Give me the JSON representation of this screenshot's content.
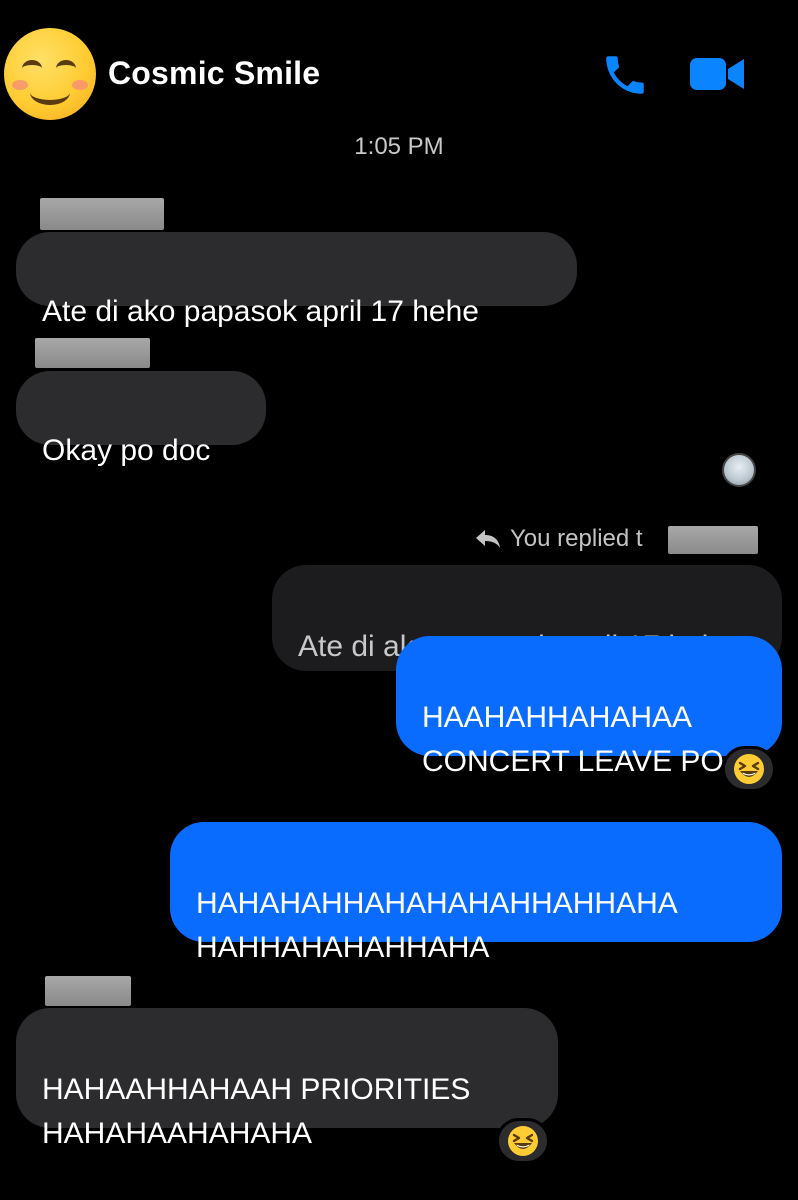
{
  "header": {
    "contact_name": "Cosmic Smile",
    "avatar": "smiling-face-emoji",
    "call_icon": "phone-icon",
    "video_icon": "video-camera-icon",
    "accent_color": "#0a84ff"
  },
  "timestamp": "1:05 PM",
  "messages": [
    {
      "direction": "incoming",
      "text": "Ate di ako papasok april 17 hehe"
    },
    {
      "direction": "incoming",
      "text": "Okay po doc"
    },
    {
      "direction": "outgoing",
      "reply_label": "You replied t",
      "quoted_text": "Ate di ako papasok april 17 hehe",
      "text": "HAAHAHHAHAHAA\nCONCERT LEAVE PO",
      "reaction": "grinning-squinting-face-emoji"
    },
    {
      "direction": "outgoing",
      "text": "HAHAHAHHAHAHAHAHHAHHAHA\nHAHHAHAHAHHAHA"
    },
    {
      "direction": "incoming",
      "text": "HAHAAHHAHAAH PRIORITIES\nHAHAHAAHAHAHA",
      "reaction": "grinning-squinting-face-emoji"
    }
  ],
  "colors": {
    "incoming_bubble": "#2c2c2e",
    "outgoing_bubble": "#0a6cff",
    "quote_bubble": "#1c1c1e",
    "background": "#000000"
  }
}
